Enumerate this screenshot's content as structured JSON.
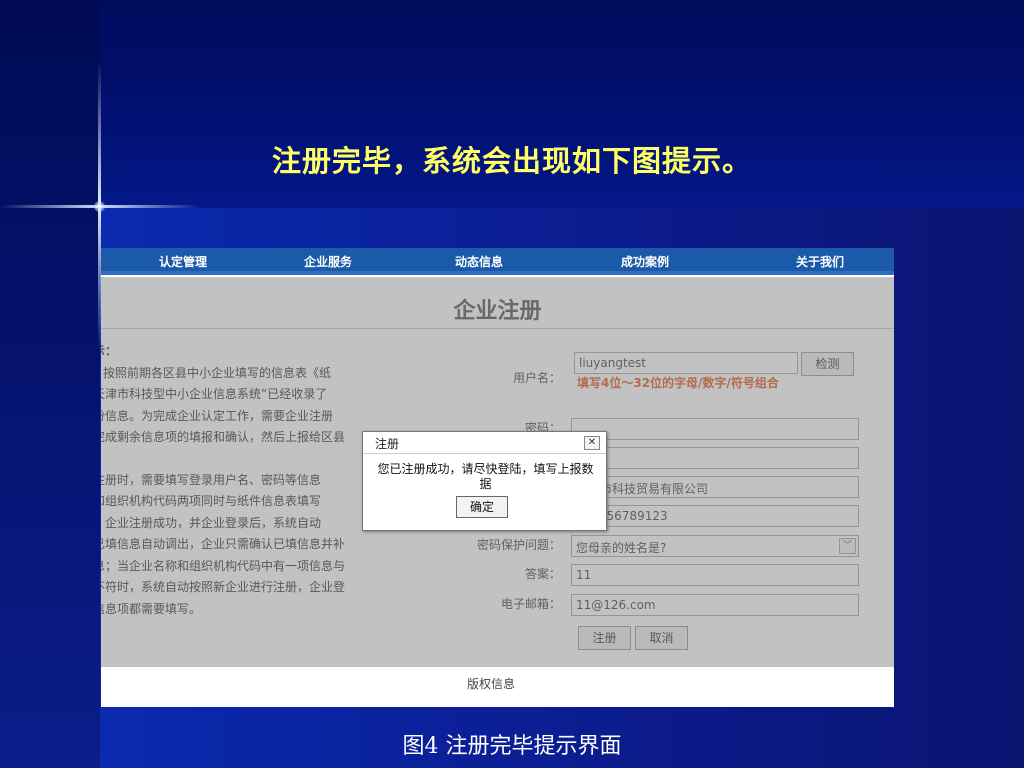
{
  "slide": {
    "title": "注册完毕，系统会出现如下图提示。",
    "caption": "图4 注册完毕提示界面"
  },
  "nav": {
    "items": [
      "认定管理",
      "企业服务",
      "动态信息",
      "成功案例",
      "关于我们"
    ]
  },
  "page": {
    "title": "企业注册",
    "notice_lines": [
      "示：",
      "  按照前期各区县中小企业填写的信息表《纸",
      "天津市科技型中小企业信息系统”已经收录了",
      "份信息。为完成企业认定工作，需要企业注册",
      "完成剩余信息项的填报和确认，然后上报给区县",
      "",
      "注册时，需要填写登录用户名、密码等信息",
      "和组织机构代码两项同时与纸件信息表填写",
      "，企业注册成功，并企业登录后，系统自动",
      "已填信息自动调出，企业只需确认已填信息并补",
      "息；当企业名称和组织机构代码中有一项信息与",
      "不符时，系统自动按照新企业进行注册，企业登",
      "信息项都需要填写。"
    ],
    "form": {
      "username_label": "用户名：",
      "username_value": "liuyangtest",
      "check_button": "检测",
      "username_hint": "填写4位～32位的字母/数字/符号组合",
      "password_label": "密码：",
      "password_value": "",
      "confirm_value": "",
      "company_value": "天津市科技贸易有限公司",
      "org_code_value": "123456789123",
      "question_label": "密码保护问题：",
      "question_value": "您母亲的姓名是?",
      "answer_label": "答案：",
      "answer_value": "11",
      "email_label": "电子邮箱：",
      "email_value": "11@126.com",
      "register_button": "注册",
      "cancel_button": "取消"
    },
    "footer": "版权信息"
  },
  "dialog": {
    "title": "注册",
    "close": "✕",
    "message": "您已注册成功，请尽快登陆，填写上报数据",
    "ok": "确定"
  },
  "colors": {
    "slide_title": "#ffff66",
    "nav_bg": "#1a5aa8",
    "hint": "#e05a1e"
  }
}
